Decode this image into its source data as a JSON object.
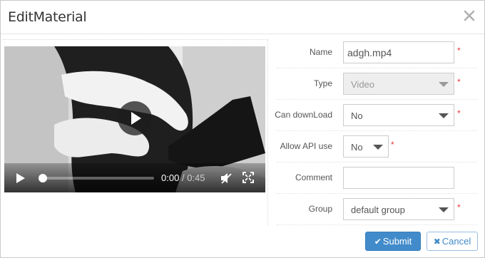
{
  "dialog": {
    "title": "EditMaterial"
  },
  "video": {
    "current_time": "0:00",
    "separator": "/",
    "duration": "0:45",
    "progress": 0
  },
  "form": {
    "name": {
      "label": "Name",
      "value": "adgh.mp4",
      "required": "*"
    },
    "type": {
      "label": "Type",
      "value": "Video",
      "required": "*"
    },
    "download": {
      "label": "Can downLoad",
      "value": "No",
      "required": "*"
    },
    "api": {
      "label": "Allow API use",
      "value": "No",
      "required": "*"
    },
    "comment": {
      "label": "Comment",
      "value": ""
    },
    "group": {
      "label": "Group",
      "value": "default group",
      "required": "*"
    }
  },
  "buttons": {
    "submit_icon": "✔",
    "submit": "Submit",
    "cancel_icon": "✖",
    "cancel": "Cancel"
  },
  "colors": {
    "primary": "#428bca",
    "required": "#e4393c"
  }
}
